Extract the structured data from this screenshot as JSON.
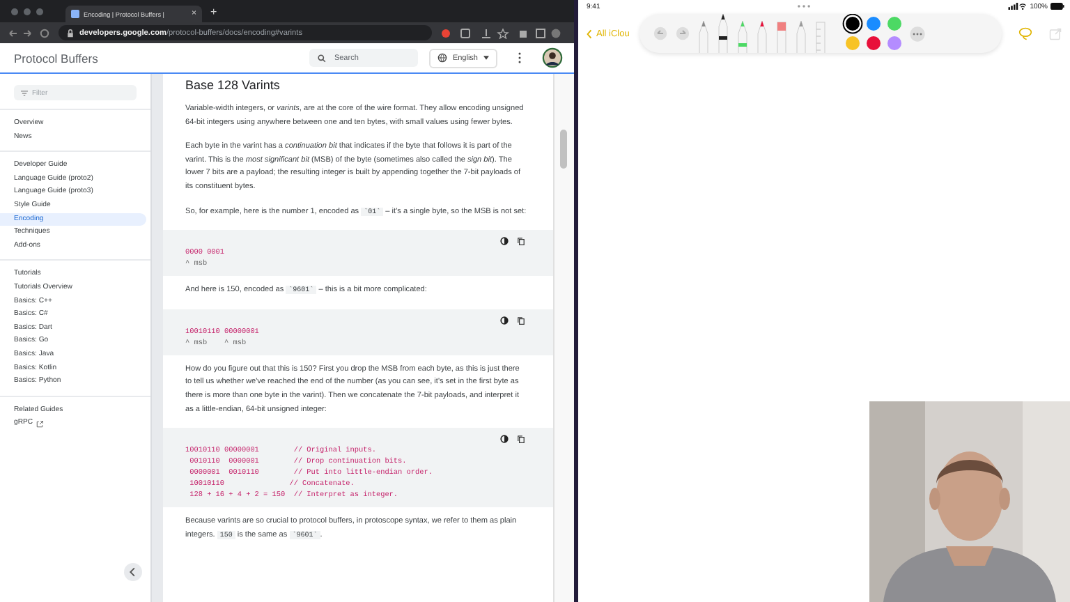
{
  "browser": {
    "tab": {
      "title": "Encoding | Protocol Buffers |",
      "close": "×"
    },
    "new_tab": "+",
    "url_host": "developers.google.com",
    "url_path": "/protocol-buffers/docs/encoding#varints"
  },
  "site": {
    "title": "Protocol Buffers",
    "search": {
      "placeholder": "Search"
    },
    "language": "English"
  },
  "sidebar": {
    "filter": {
      "placeholder": "Filter"
    },
    "groups": [
      {
        "items": [
          {
            "label": "Overview",
            "selected": false
          },
          {
            "label": "News",
            "selected": false
          }
        ]
      },
      {
        "items": [
          {
            "label": "Developer Guide",
            "selected": false
          },
          {
            "label": "Language Guide (proto2)",
            "selected": false
          },
          {
            "label": "Language Guide (proto3)",
            "selected": false
          },
          {
            "label": "Style Guide",
            "selected": false
          },
          {
            "label": "Encoding",
            "selected": true
          },
          {
            "label": "Techniques",
            "selected": false
          },
          {
            "label": "Add-ons",
            "selected": false
          }
        ]
      },
      {
        "items": [
          {
            "label": "Tutorials",
            "selected": false
          },
          {
            "label": "Tutorials Overview",
            "selected": false
          },
          {
            "label": "Basics: C++",
            "selected": false
          },
          {
            "label": "Basics: C#",
            "selected": false
          },
          {
            "label": "Basics: Dart",
            "selected": false
          },
          {
            "label": "Basics: Go",
            "selected": false
          },
          {
            "label": "Basics: Java",
            "selected": false
          },
          {
            "label": "Basics: Kotlin",
            "selected": false
          },
          {
            "label": "Basics: Python",
            "selected": false
          }
        ]
      },
      {
        "items": [
          {
            "label": "Related Guides",
            "selected": false,
            "external": false
          },
          {
            "label": "gRPC",
            "selected": false,
            "external": true
          }
        ]
      }
    ]
  },
  "article": {
    "heading": "Base 128 Varints",
    "blocks": [
      {
        "kind": "para",
        "parts": [
          {
            "kind": "text",
            "t": "Variable-width integers, or *varints*, are at the core of the wire format. They allow encoding unsigned 64-bit integers using anywhere between one and ten bytes, with small values using fewer bytes."
          }
        ]
      },
      {
        "kind": "para",
        "parts": [
          {
            "kind": "text",
            "t": "Each byte in the varint has a *continuation bit* that indicates if the byte that follows it is part of the varint. This is the *most significant bit* (MSB) of the byte (sometimes also called the *sign bit*). The lower 7 bits are a payload; the resulting integer is built by appending together the 7-bit payloads of its constituent bytes."
          }
        ]
      },
      {
        "kind": "para",
        "parts": [
          {
            "kind": "text",
            "t": "So, for example, here is the number 1, encoded as "
          },
          {
            "kind": "code",
            "t": "`01`"
          },
          {
            "kind": "text",
            "t": " – it's a single byte, so the MSB is not set:"
          }
        ]
      },
      {
        "kind": "code",
        "lines": [
          {
            "kind": "code",
            "t": "0000 0001"
          },
          {
            "kind": "note",
            "t": "^ msb"
          }
        ]
      },
      {
        "kind": "para",
        "parts": [
          {
            "kind": "text",
            "t": "And here is 150, encoded as "
          },
          {
            "kind": "code",
            "t": "`9601`"
          },
          {
            "kind": "text",
            "t": " – this is a bit more complicated:"
          }
        ]
      },
      {
        "kind": "code",
        "lines": [
          {
            "kind": "code",
            "t": "10010110 00000001"
          },
          {
            "kind": "note",
            "t": "^ msb    ^ msb"
          }
        ]
      },
      {
        "kind": "para",
        "parts": [
          {
            "kind": "text",
            "t": "How do you figure out that this is 150? First you drop the MSB from each byte, as this is just there to tell us whether we've reached the end of the number (as you can see, it's set in the first byte as there is more than one byte in the varint). Then we concatenate the 7-bit payloads, and interpret it as a little-endian, 64-bit unsigned integer:"
          }
        ]
      },
      {
        "kind": "code",
        "lines": [
          {
            "kind": "code",
            "t": "10010110 00000001        // Original inputs."
          },
          {
            "kind": "code",
            "t": " 0010110  0000001        // Drop continuation bits."
          },
          {
            "kind": "code",
            "t": " 0000001  0010110        // Put into little-endian order."
          },
          {
            "kind": "code",
            "t": " 10010110               // Concatenate."
          },
          {
            "kind": "code",
            "t": " 128 + 16 + 4 + 2 = 150  // Interpret as integer."
          }
        ]
      },
      {
        "kind": "para",
        "parts": [
          {
            "kind": "text",
            "t": "Because varints are so crucial to protocol buffers, in protoscope syntax, we refer to them as plain integers. "
          },
          {
            "kind": "code",
            "t": "150"
          },
          {
            "kind": "text",
            "t": " is the same as "
          },
          {
            "kind": "code",
            "t": "`9601`"
          },
          {
            "kind": "text",
            "t": "."
          }
        ]
      }
    ]
  },
  "ipad": {
    "time": "9:41",
    "battery": "100%",
    "back": "All iClou",
    "tools": [
      {
        "kind": "fountain",
        "selected": false
      },
      {
        "kind": "pen",
        "selected": true
      },
      {
        "kind": "marker",
        "selected": false
      },
      {
        "kind": "crayon",
        "selected": false
      },
      {
        "kind": "eraser",
        "selected": false
      },
      {
        "kind": "pencil",
        "selected": false
      },
      {
        "kind": "ruler",
        "selected": false
      }
    ],
    "colors": [
      {
        "color": "#000000",
        "selected": true
      },
      {
        "color": "#1a8cff",
        "selected": false
      },
      {
        "color": "#4cd964",
        "selected": false
      },
      {
        "color": "#f7c325",
        "selected": false
      },
      {
        "color": "#e8103a",
        "selected": false
      },
      {
        "color": "#b48cff",
        "selected": false
      }
    ]
  }
}
